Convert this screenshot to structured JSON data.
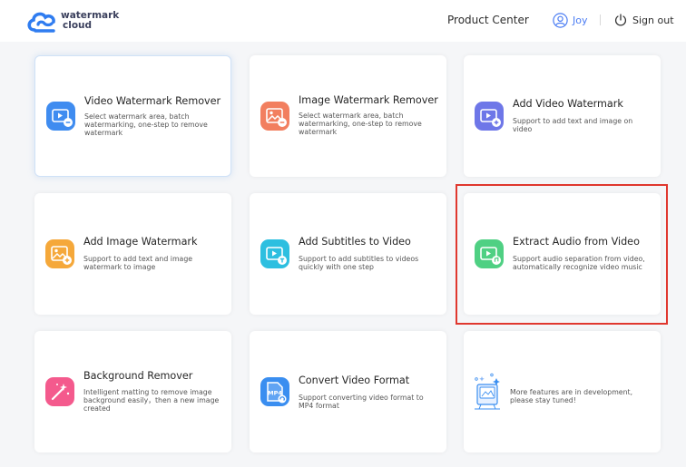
{
  "header": {
    "logo_line1": "watermark",
    "logo_line2": "cloud",
    "product_center": "Product Center",
    "user_name": "Joy",
    "sign_out": "Sign out"
  },
  "cards": [
    {
      "title": "Video Watermark Remover",
      "desc": "Select watermark area, batch watermarking, one-step to remove watermark",
      "icon": "video-icon",
      "color": "#3f8cf0"
    },
    {
      "title": "Image Watermark Remover",
      "desc": "Select watermark area, batch watermarking, one-step to remove watermark",
      "icon": "image-icon",
      "color": "#f27f5f"
    },
    {
      "title": "Add Video Watermark",
      "desc": "Support to add text and image on video",
      "icon": "video-icon",
      "color": "#6e77e8"
    },
    {
      "title": "Add Image Watermark",
      "desc": "Support to add text and image watermark to image",
      "icon": "image-icon",
      "color": "#f5a83a"
    },
    {
      "title": "Add Subtitles to Video",
      "desc": "Support to add subtitles to videos quickly with one step",
      "icon": "subtitles-icon",
      "color": "#2dbfe0"
    },
    {
      "title": "Extract Audio from Video",
      "desc": "Support audio separation from video, automatically recognize video music",
      "icon": "audio-icon",
      "color": "#4fd083"
    },
    {
      "title": "Background Remover",
      "desc": "Intelligent matting to remove image background easily，then a new image created",
      "icon": "magic-wand-icon",
      "color": "#f45a8d"
    },
    {
      "title": "Convert Video Format",
      "desc": "Support converting video format to MP4 format",
      "icon": "mp4-file-icon",
      "color": "#3a8ef0",
      "badge": "MP4"
    },
    {
      "desc": "More features are in development, please stay tuned!",
      "icon": "development-illustration-icon"
    }
  ],
  "colors": {
    "accent": "#4a7cf3",
    "highlight": "#e0382f"
  }
}
